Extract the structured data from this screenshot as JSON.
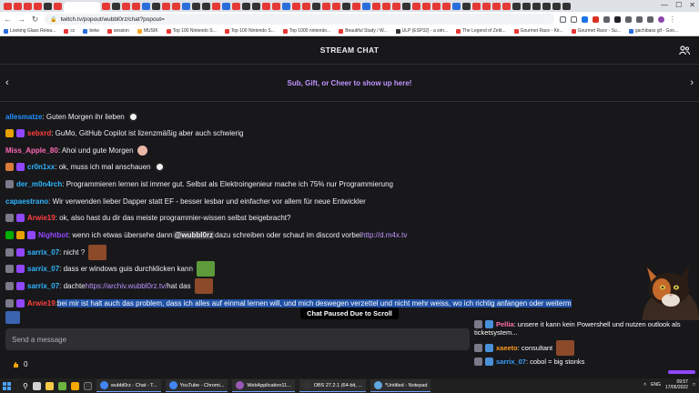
{
  "browser": {
    "url": "twitch.tv/popout/wubbl0rz/chat?popout=",
    "bookmarks": [
      {
        "label": "Looking Glass Relea...",
        "color": "#2a6edb"
      },
      {
        "label": "cc",
        "color": "#e53935"
      },
      {
        "label": "betw",
        "color": "#2a6edb"
      },
      {
        "label": "session",
        "color": "#e53935"
      },
      {
        "label": "MUSIK",
        "color": "#f9a825"
      },
      {
        "label": "Top 100 Nintendo S...",
        "color": "#e53935"
      },
      {
        "label": "Top 100 Nintendo S...",
        "color": "#e53935"
      },
      {
        "label": "Top 1000 nintendo...",
        "color": "#e53935"
      },
      {
        "label": "Beautiful Study / W...",
        "color": "#e53935"
      },
      {
        "label": "ULP (ESP32) - a sim...",
        "color": "#333333"
      },
      {
        "label": "The Legend of Zeld...",
        "color": "#e53935"
      },
      {
        "label": "Gourmet Race - Kir...",
        "color": "#e53935"
      },
      {
        "label": "Gourmet Race - Su...",
        "color": "#e53935"
      },
      {
        "label": "gachibass gif - Goo...",
        "color": "#2a6edb"
      }
    ]
  },
  "chat": {
    "header_title": "STREAM CHAT",
    "promo_text": "Sub, Gift, or Cheer to show up here!",
    "paused_label": "Chat Paused Due to Scroll",
    "send_placeholder": "Send a message",
    "points": "0",
    "messages": [
      {
        "user": "allesmatze",
        "color": "#1e90ff",
        "text": ": Guten Morgen ihr lieben",
        "badges": [],
        "emote": "panda"
      },
      {
        "user": "sebxrd",
        "color": "#ff4040",
        "text": ": GuMo, GitHub Copilot ist lizenzmäßig aber auch schwierig",
        "badges": [
          "#e8a100",
          "#9147ff"
        ],
        "emote": ""
      },
      {
        "user": "Miss_Apple_80",
        "color": "#ff69b4",
        "text": ": Ahoi und gute Morgen",
        "badges": [],
        "emote": "girl"
      },
      {
        "user": "cr0n1xx",
        "color": "#2fb5ff",
        "text": ": ok, muss ich mal anschauen",
        "badges": [
          "#d97a3a",
          "#9147ff"
        ],
        "emote": "panda"
      },
      {
        "user": "der_m0n4rch",
        "color": "#2fb5ff",
        "text": ": Programmieren lernen ist immer gut. Selbst als Elektroingenieur mache ich 75% nur Programmierung",
        "badges": [
          "#7a7a8a"
        ],
        "emote": ""
      },
      {
        "user": "capaestrano",
        "color": "#2fb5ff",
        "text": ": Wir verwenden lieber Dapper statt EF - besser lesbar und einfacher vor allem für neue Entwickler",
        "badges": [],
        "emote": ""
      },
      {
        "user": "Arwie19",
        "color": "#ff4040",
        "text": ": ok, also hast du dir das meiste programmier-wissen selbst beigebracht?",
        "badges": [
          "#7a7a8a",
          "#9147ff"
        ],
        "emote": ""
      },
      {
        "user": "Nightbot",
        "color": "#9147ff",
        "text": ": wenn ich etwas übersehe dann ",
        "badges": [
          "#00ad03",
          "#e8a100",
          "#9147ff"
        ],
        "mention": "@wubbl0rz",
        "text2": " dazu schreiben oder schaut im discord vorbei ",
        "link": "http://d.m4x.tv"
      },
      {
        "user": "sarrix_07",
        "color": "#2fb5ff",
        "text": ": nicht ?",
        "badges": [
          "#7a7a8a",
          "#9147ff"
        ],
        "emote": "face"
      },
      {
        "user": "sarrix_07",
        "color": "#2fb5ff",
        "text": ": dass er windows guis durchklicken kann",
        "badges": [
          "#7a7a8a",
          "#9147ff"
        ],
        "emote": "frog"
      },
      {
        "user": "sarrix_07",
        "color": "#2fb5ff",
        "text": ": dachte ",
        "badges": [
          "#7a7a8a",
          "#9147ff"
        ],
        "link": "https://archiv.wubbl0rz.tv/",
        "text2": " hat das",
        "emote": "face"
      },
      {
        "user": "Arwie19",
        "color": "#ff4040",
        "text": ": ",
        "badges": [
          "#7a7a8a",
          "#9147ff"
        ],
        "highlight": "bei mir ist halt auch das problem, dass ich alles auf einmal lernen will, und mich deswegen verzettel und nicht mehr weiss, wo ich richtig anfangen oder weiterm"
      }
    ]
  },
  "overlay": {
    "lines": [
      {
        "user": "Pellia",
        "color": "#ff6fa6",
        "text": ": unsere it kann kein Powershell und nutzen outlook als",
        "cont": "ticketsystem..."
      },
      {
        "user": "xaeeto",
        "color": "#ff9a1f",
        "text": ": consultant",
        "emote": "face"
      },
      {
        "user": "sarrix_07",
        "color": "#3aa0ff",
        "text": ": cobol = big stonks"
      }
    ]
  },
  "taskbar": {
    "apps": [
      {
        "label": "wubbl0rz - Chat - T...",
        "color": "#4285f4"
      },
      {
        "label": "YouTube - Chromi...",
        "color": "#4285f4"
      },
      {
        "label": "WebApplication11...",
        "color": "#9b59b6"
      },
      {
        "label": "OBS 27.2.1 (64-bit, ...",
        "color": "#333333"
      },
      {
        "label": "*Untitled - Notepad",
        "color": "#5fa8e0"
      }
    ],
    "lang": "ENG",
    "time": "09:57",
    "date": "17/05/2022"
  }
}
